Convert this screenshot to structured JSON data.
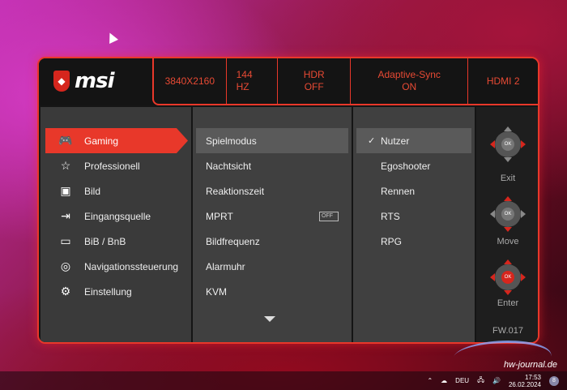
{
  "brand": {
    "logo_text": "msi",
    "logo_icon": "msi-dragon-shield-icon"
  },
  "status_bar": {
    "resolution": "3840X2160",
    "refresh": "144 HZ",
    "hdr": {
      "label": "HDR",
      "value": "OFF"
    },
    "adaptive_sync": {
      "label": "Adaptive-Sync",
      "value": "ON"
    },
    "input": "HDMI 2"
  },
  "main_menu": [
    {
      "label": "Gaming",
      "icon": "gamepad-icon",
      "active": true
    },
    {
      "label": "Professionell",
      "icon": "star-icon"
    },
    {
      "label": "Bild",
      "icon": "image-icon"
    },
    {
      "label": "Eingangsquelle",
      "icon": "input-source-icon"
    },
    {
      "label": "BiB / BnB",
      "icon": "pip-icon"
    },
    {
      "label": "Navigationssteuerung",
      "icon": "navigation-icon"
    },
    {
      "label": "Einstellung",
      "icon": "gear-icon"
    }
  ],
  "sub_menu": [
    {
      "label": "Spielmodus",
      "active": true
    },
    {
      "label": "Nachtsicht"
    },
    {
      "label": "Reaktionszeit"
    },
    {
      "label": "MPRT",
      "toggle": "OFF"
    },
    {
      "label": "Bildfrequenz"
    },
    {
      "label": "Alarmuhr"
    },
    {
      "label": "KVM"
    }
  ],
  "options": [
    {
      "label": "Nutzer",
      "selected": true
    },
    {
      "label": "Egoshooter"
    },
    {
      "label": "Rennen"
    },
    {
      "label": "RTS"
    },
    {
      "label": "RPG"
    }
  ],
  "controls": {
    "ok_label": "OK",
    "exit": "Exit",
    "move": "Move",
    "enter": "Enter",
    "firmware": "FW.017"
  },
  "taskbar": {
    "language": "DEU",
    "time": "17:53",
    "date": "26.02.2024",
    "notifications": "8"
  },
  "watermark": "hw-journal.de",
  "colors": {
    "accent": "#e8382a",
    "panel_dark": "#151515",
    "panel_mid": "#404040"
  }
}
